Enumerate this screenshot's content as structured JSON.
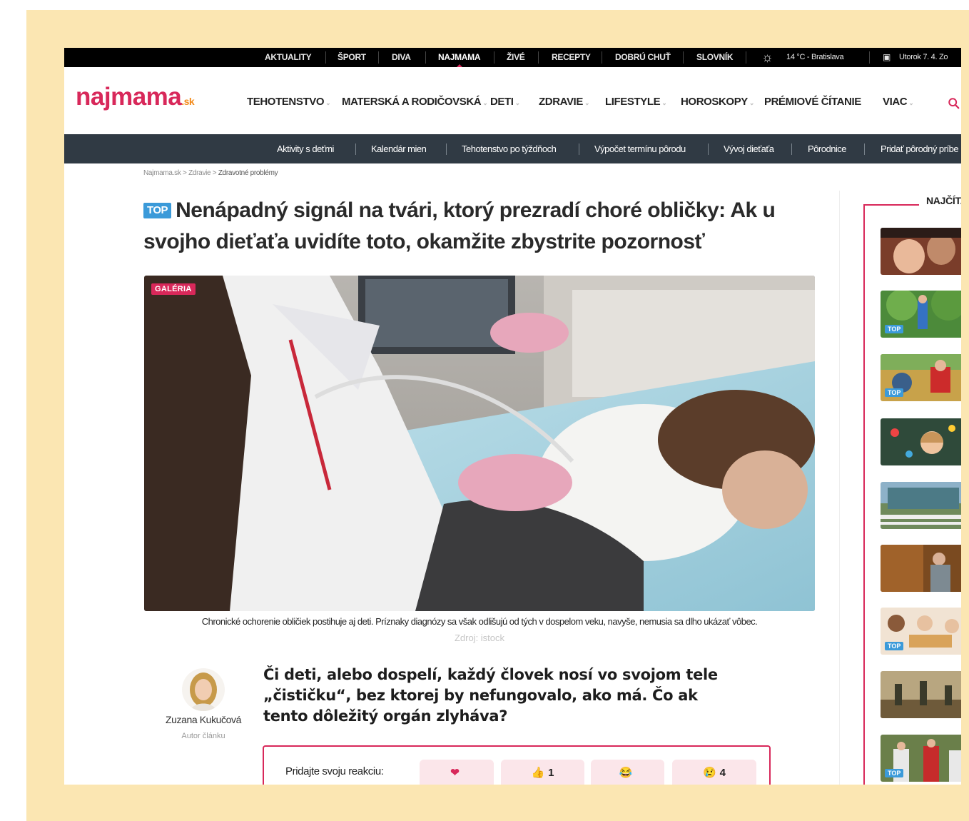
{
  "topbar": {
    "items": [
      "AKTUALITY",
      "ŠPORT",
      "DIVA",
      "NAJMAMA",
      "ŽIVÉ",
      "RECEPTY",
      "DOBRÚ CHUŤ",
      "SLOVNÍK"
    ],
    "weather": "14 °C - Bratislava",
    "date": "Utorok 7. 4. Zo"
  },
  "logo": {
    "name": "najmama",
    "tld": ".sk"
  },
  "mainnav": {
    "items": [
      "TEHOTENSTVO",
      "MATERSKÁ A RODIČOVSKÁ",
      "DETI",
      "ZDRAVIE",
      "LIFESTYLE",
      "HOROSKOPY",
      "PRÉMIOVÉ ČÍTANIE",
      "VIAC"
    ]
  },
  "subnav": {
    "items": [
      "Aktivity s deťmi",
      "Kalendár mien",
      "Tehotenstvo po týždňoch",
      "Výpočet termínu pôrodu",
      "Vývoj dieťaťa",
      "Pôrodnice",
      "Pridať pôrodný príbe"
    ]
  },
  "breadcrumb": {
    "home": "Najmama.sk",
    "section": "Zdravie",
    "current": "Zdravotné problémy"
  },
  "article": {
    "badge": "TOP",
    "title": "Nenápadný signál na tvári, ktorý prezradí choré obličky: Ak u svojho dieťaťa uvidíte toto, okamžite zbystrite pozornosť",
    "gallery_badge": "GALÉRIA",
    "caption": "Chronické ochorenie obličiek postihuje aj deti. Príznaky diagnózy sa však odlišujú od tých v dospelom veku, navyše, nemusia sa dlho ukázať vôbec.",
    "source": "Zdroj: istock",
    "author": {
      "name": "Zuzana Kukučová",
      "role": "Autor článku"
    },
    "lead": "Či deti, alebo dospelí, každý človek nosí vo svojom tele „čističku“, bez ktorej by nefungovalo, ako má. Čo ak tento dôležitý orgán zlyháva?"
  },
  "reactions": {
    "label": "Pridajte svoju reakciu:",
    "items": [
      {
        "icon": "heart-icon",
        "glyph": "❤",
        "count": ""
      },
      {
        "icon": "thumbs-up-icon",
        "glyph": "👍",
        "count": "1"
      },
      {
        "icon": "laugh-icon",
        "glyph": "😂",
        "count": ""
      },
      {
        "icon": "sad-icon",
        "glyph": "😢",
        "count": "4"
      }
    ]
  },
  "sidebar": {
    "title": "NAJČÍTA",
    "thumbs": [
      {
        "top": false,
        "badge": ""
      },
      {
        "top": true,
        "badge": "TOP"
      },
      {
        "top": true,
        "badge": "TOP"
      },
      {
        "top": false,
        "badge": ""
      },
      {
        "top": false,
        "badge": ""
      },
      {
        "top": false,
        "badge": ""
      },
      {
        "top": true,
        "badge": "TOP"
      },
      {
        "top": false,
        "badge": ""
      },
      {
        "top": true,
        "badge": "TOP"
      }
    ]
  },
  "colors": {
    "brand": "#d8285a",
    "accent": "#3b9ad9",
    "subnav": "#303a44",
    "frame": "#fbe6b2"
  }
}
